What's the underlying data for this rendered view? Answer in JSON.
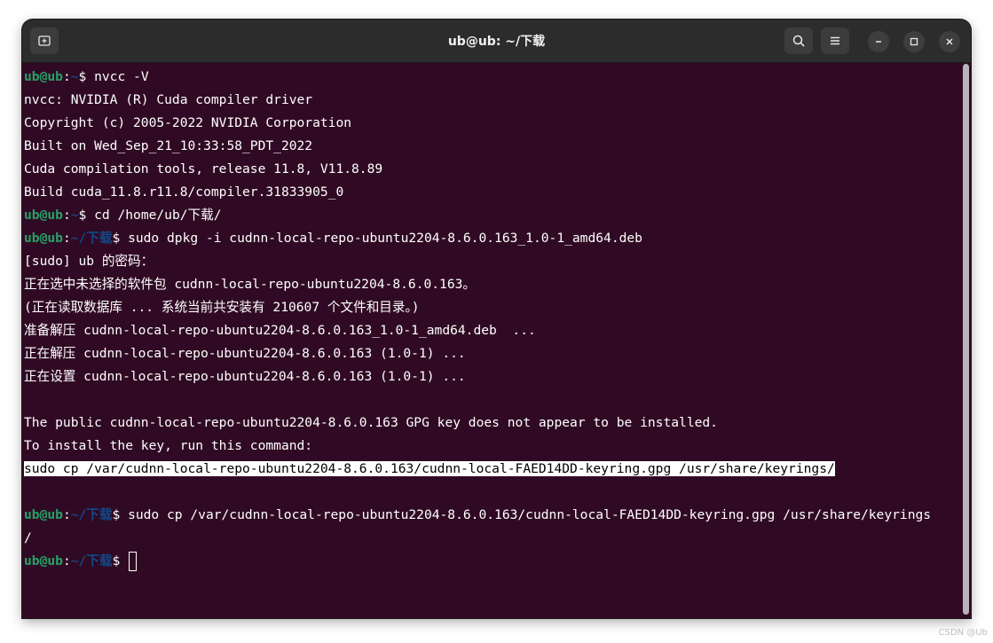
{
  "window": {
    "title": "ub@ub: ~/下载"
  },
  "colors": {
    "terminal_bg": "#300a24",
    "prompt_user": "#26a269",
    "prompt_path": "#12488b",
    "text": "#ffffff"
  },
  "icons": {
    "new_tab": "new-tab-icon",
    "search": "search-icon",
    "menu": "hamburger-menu-icon",
    "minimize": "minimize-icon",
    "maximize": "maximize-icon",
    "close": "close-icon"
  },
  "terminal": {
    "lines": [
      {
        "user": "ub@ub",
        "sep": ":",
        "path": "~",
        "sym": "$ ",
        "cmd": "nvcc -V"
      },
      {
        "text": "nvcc: NVIDIA (R) Cuda compiler driver"
      },
      {
        "text": "Copyright (c) 2005-2022 NVIDIA Corporation"
      },
      {
        "text": "Built on Wed_Sep_21_10:33:58_PDT_2022"
      },
      {
        "text": "Cuda compilation tools, release 11.8, V11.8.89"
      },
      {
        "text": "Build cuda_11.8.r11.8/compiler.31833905_0"
      },
      {
        "user": "ub@ub",
        "sep": ":",
        "path": "~",
        "sym": "$ ",
        "cmd": "cd /home/ub/下载/"
      },
      {
        "user": "ub@ub",
        "sep": ":",
        "path": "~/下载",
        "sym": "$ ",
        "cmd": "sudo dpkg -i cudnn-local-repo-ubuntu2204-8.6.0.163_1.0-1_amd64.deb"
      },
      {
        "text": "[sudo] ub 的密码："
      },
      {
        "text": "正在选中未选择的软件包 cudnn-local-repo-ubuntu2204-8.6.0.163。"
      },
      {
        "text": "(正在读取数据库 ... 系统当前共安装有 210607 个文件和目录。)"
      },
      {
        "text": "准备解压 cudnn-local-repo-ubuntu2204-8.6.0.163_1.0-1_amd64.deb  ..."
      },
      {
        "text": "正在解压 cudnn-local-repo-ubuntu2204-8.6.0.163 (1.0-1) ..."
      },
      {
        "text": "正在设置 cudnn-local-repo-ubuntu2204-8.6.0.163 (1.0-1) ..."
      },
      {
        "text": ""
      },
      {
        "text": "The public cudnn-local-repo-ubuntu2204-8.6.0.163 GPG key does not appear to be installed."
      },
      {
        "text": "To install the key, run this command:"
      },
      {
        "text": "sudo cp /var/cudnn-local-repo-ubuntu2204-8.6.0.163/cudnn-local-FAED14DD-keyring.gpg /usr/share/keyrings/",
        "highlight": true
      },
      {
        "text": ""
      },
      {
        "user": "ub@ub",
        "sep": ":",
        "path": "~/下载",
        "sym": "$ ",
        "cmd": "sudo cp /var/cudnn-local-repo-ubuntu2204-8.6.0.163/cudnn-local-FAED14DD-keyring.gpg /usr/share/keyrings"
      },
      {
        "text": "/"
      },
      {
        "user": "ub@ub",
        "sep": ":",
        "path": "~/下载",
        "sym": "$ ",
        "cmd": "",
        "cursor": true
      }
    ]
  },
  "watermark": "CSDN @Ub"
}
